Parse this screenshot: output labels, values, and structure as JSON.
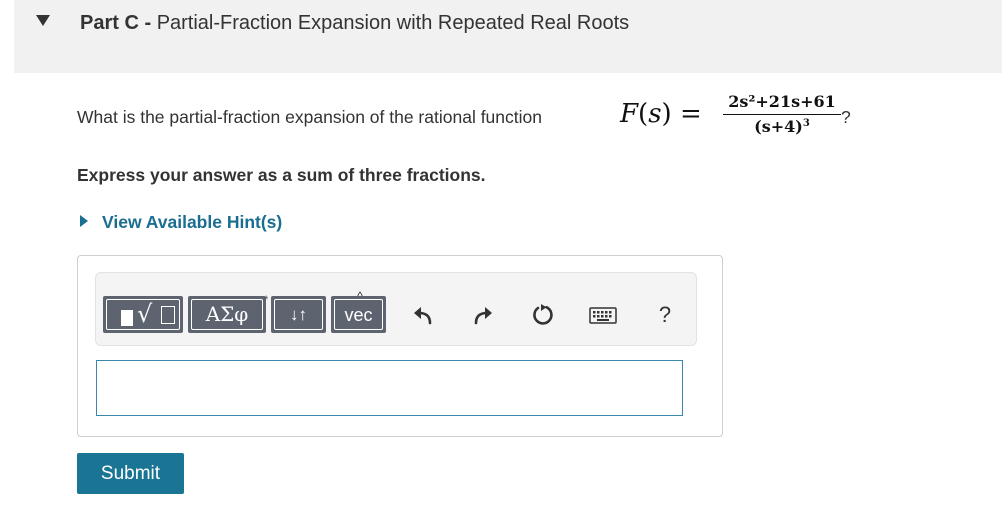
{
  "part": {
    "label": "Part C",
    "separator": " - ",
    "title": "Partial-Fraction Expansion with Repeated Real Roots"
  },
  "question": {
    "prefix": "What is the partial-fraction expansion of the rational function",
    "function_name": "F",
    "variable": "s",
    "numerator": "2s²+21s+61",
    "denominator_base": "(s+4)",
    "denominator_exponent": "3",
    "suffix": "?"
  },
  "instruction": "Express your answer as a sum of three fractions.",
  "hint_link": "View Available Hint(s)",
  "toolbar": {
    "greek_label": "ΑΣφ",
    "arrows_label": "↓↑",
    "vec_label": "vec",
    "help_label": "?",
    "icons": [
      "templates-icon",
      "undo-icon",
      "redo-icon",
      "reset-icon",
      "keyboard-icon",
      "help-icon"
    ]
  },
  "answer_input": {
    "value": "",
    "placeholder": ""
  },
  "submit_label": "Submit",
  "colors": {
    "accent": "#1a7493",
    "hint_link": "#1a6e90",
    "toolbar_button": "#5d6470",
    "header_bg": "#f1f1f1"
  }
}
